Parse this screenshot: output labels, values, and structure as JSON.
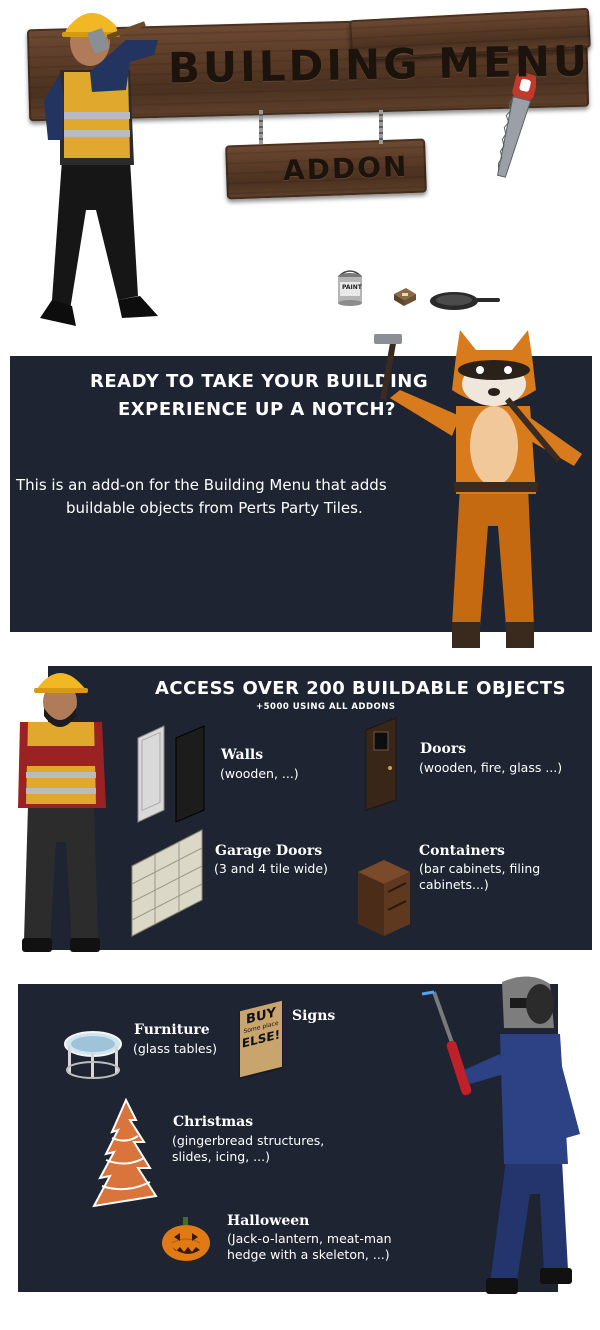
{
  "header": {
    "title": "BUILDING MENU",
    "subtitle": "ADDON"
  },
  "intro": {
    "headline_line1": "READY TO TAKE YOUR BUILDING",
    "headline_line2": "EXPERIENCE UP A NOTCH?",
    "body_line1": "This is an add-on for the Building Menu that adds",
    "body_line2": "buildable objects from Perts Party Tiles."
  },
  "access": {
    "headline": "ACCESS OVER 200 BUILDABLE OBJECTS",
    "subheadline": "+5000 USING ALL ADDONS",
    "items": [
      {
        "title": "Walls",
        "desc_lines": [
          "(wooden, ...)"
        ]
      },
      {
        "title": "Doors",
        "desc_lines": [
          "(wooden, fire, glass ...)"
        ]
      },
      {
        "title": "Garage Doors",
        "desc_lines": [
          "(3 and 4 tile wide)"
        ]
      },
      {
        "title": "Containers",
        "desc_lines": [
          "(bar cabinets, filing",
          "cabinets...)"
        ]
      }
    ]
  },
  "more": {
    "items": [
      {
        "title": "Furniture",
        "desc_lines": [
          "(glass tables)"
        ]
      },
      {
        "title": "Signs",
        "desc_lines": []
      },
      {
        "title": "Christmas",
        "desc_lines": [
          "(gingerbread structures,",
          "slides, icing, ...)"
        ]
      },
      {
        "title": "Halloween",
        "desc_lines": [
          "(Jack-o-lantern, meat-man",
          "hedge with a skeleton, ...)"
        ]
      }
    ],
    "sign_lines": [
      "BUY",
      "Some place",
      "ELSE!"
    ]
  },
  "paint_can_label": "PAINT",
  "colors": {
    "panel_bg": "#1e2432",
    "wood": "#5a3b27",
    "text": "#ffffff"
  }
}
